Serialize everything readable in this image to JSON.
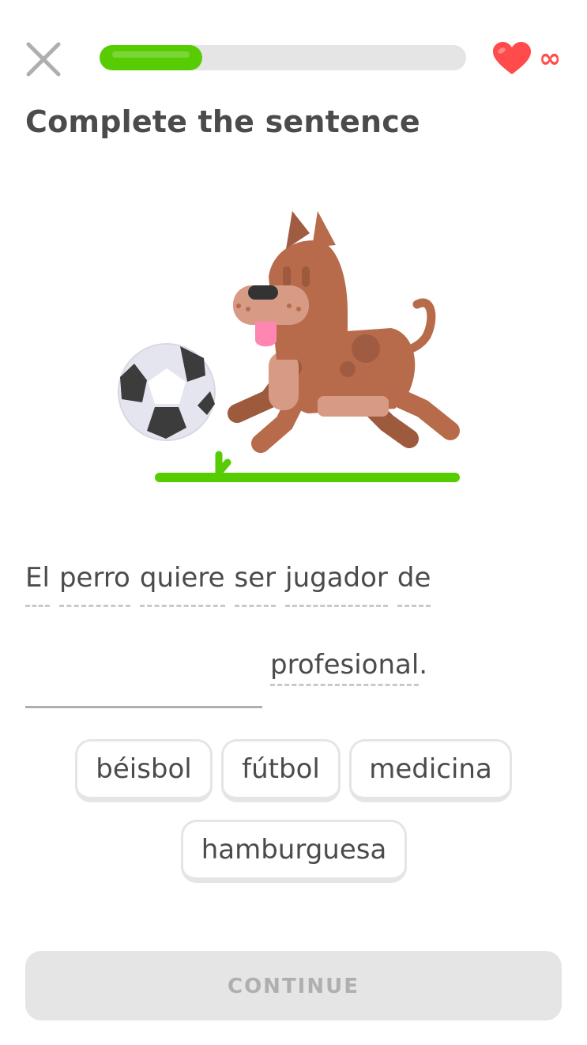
{
  "header": {
    "close_icon": "close-icon",
    "progress": 0.28,
    "hearts_icon": "heart-icon",
    "hearts_value": "∞",
    "colors": {
      "progress": "#58cc02",
      "heart": "#ff4b4b"
    }
  },
  "title": "Complete the sentence",
  "illustration": {
    "description_icon": "dog-kicking-soccer-ball"
  },
  "sentence": {
    "line1_words": [
      "El",
      "perro",
      "quiere",
      "ser",
      "jugador",
      "de"
    ],
    "after_blank": "profesional",
    "after_blank_punct": "."
  },
  "options": [
    "béisbol",
    "fútbol",
    "medicina",
    "hamburguesa"
  ],
  "continue_label": "CONTINUE"
}
